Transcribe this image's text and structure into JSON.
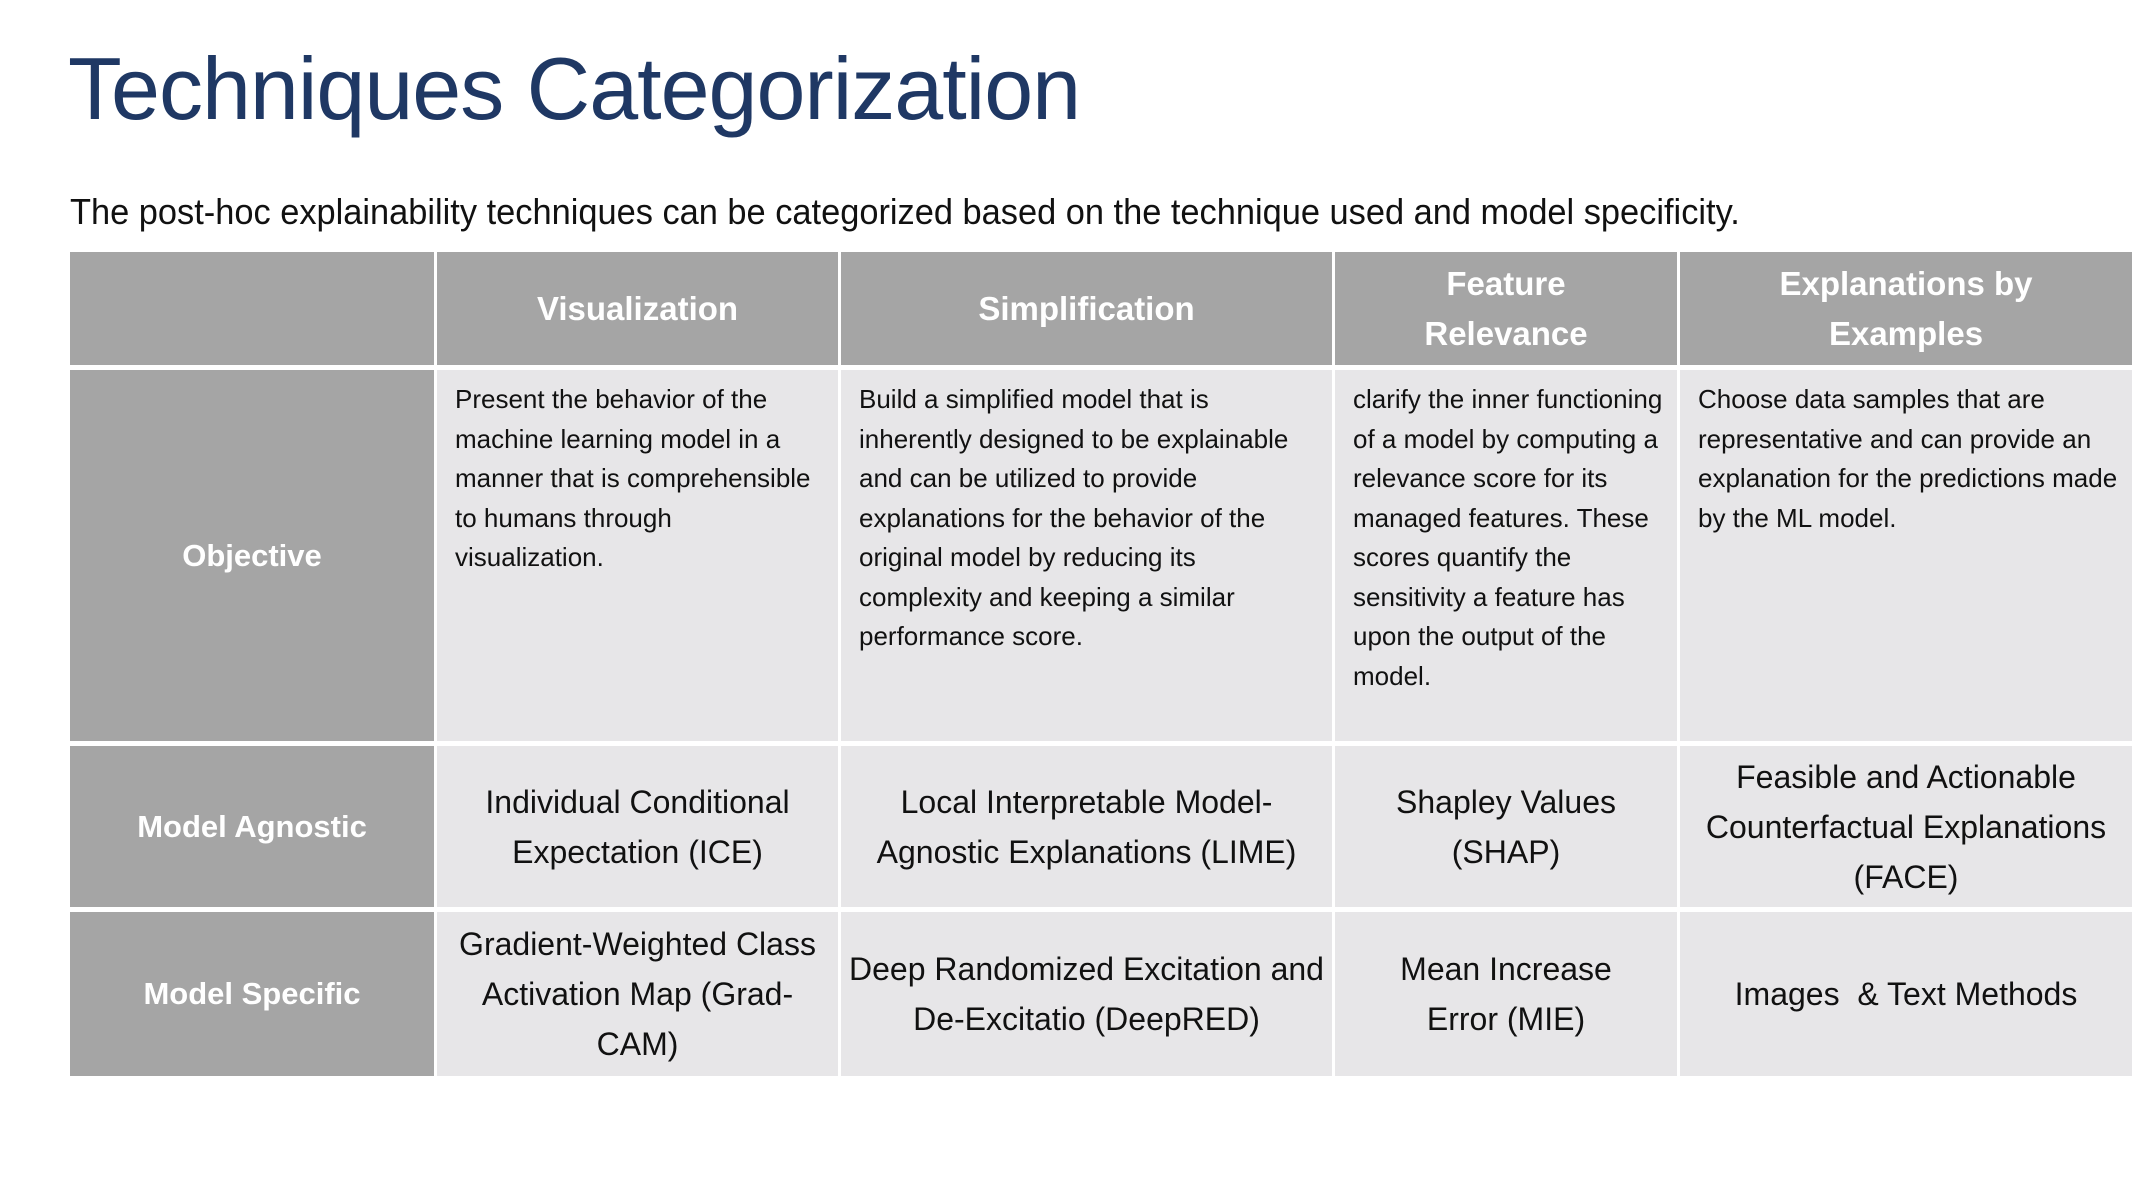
{
  "slide": {
    "title": "Techniques Categorization",
    "subtitle": "The post-hoc explainability techniques can be categorized based on the technique used and model specificity.",
    "colors": {
      "title": "#1f3864",
      "header_bg": "#a5a5a5",
      "cell_bg": "#e7e6e8",
      "divider": "#ffffff"
    }
  },
  "table": {
    "corner_label": "",
    "columns": [
      "Visualization",
      "Simplification",
      "Feature Relevance",
      "Explanations by Examples"
    ],
    "rows": [
      {
        "label": "Objective",
        "cells": [
          "Present the behavior of the machine learning model in a manner that is comprehensible to humans through visualization.",
          "Build a simplified  model that is inherently designed to be explainable and can be utilized to provide explanations for the behavior of the original model by reducing its complexity and keeping a similar performance score.",
          "clarify the inner functioning of a model by computing a relevance score for its managed features. These scores quantify the sensitivity a feature has upon the output of the model.",
          "Choose data samples that are representative and can provide an explanation for the predictions made by the ML model."
        ]
      },
      {
        "label": "Model Agnostic",
        "cells": [
          "Individual Conditional Expectation (ICE)",
          "Local Interpretable Model-Agnostic Explanations (LIME)",
          "Shapley Values (SHAP)",
          "Feasible and Actionable Counterfactual Explanations (FACE)"
        ]
      },
      {
        "label": "Model Specific",
        "cells": [
          "Gradient-Weighted Class Activation Map (Grad-CAM)",
          "Deep Randomized Excitation and De-Excitatio (DeepRED)",
          "Mean Increase Error (MIE)",
          "Images  & Text Methods"
        ]
      }
    ]
  }
}
